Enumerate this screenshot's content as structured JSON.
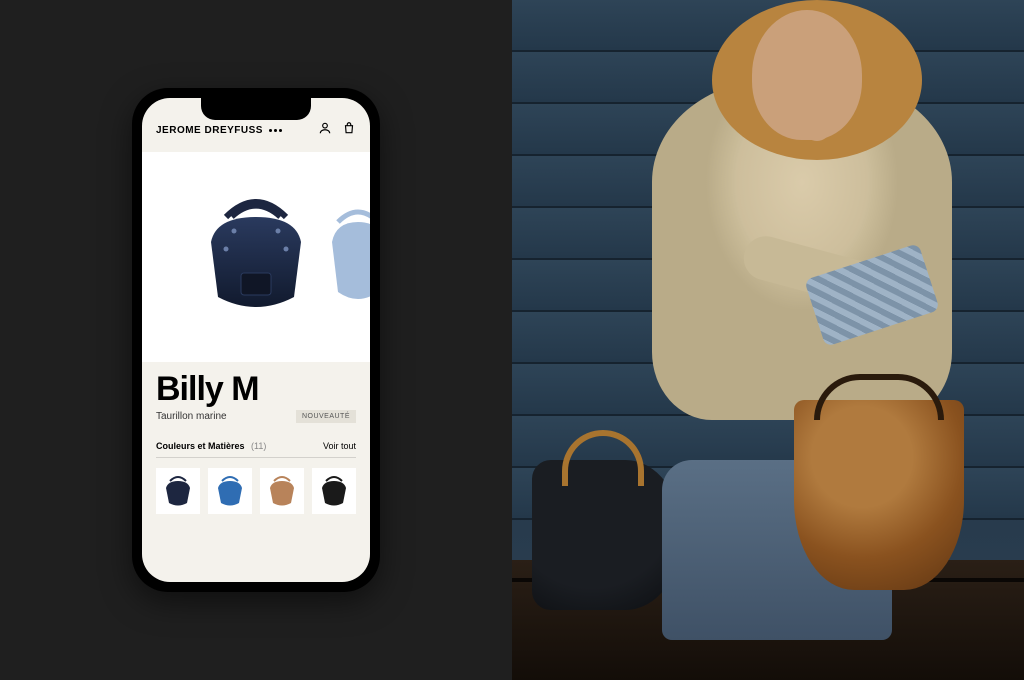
{
  "brand": "JEROME DREYFUSS",
  "product": {
    "name": "Billy M",
    "material": "Taurillon marine",
    "badge": "NOUVEAUTÉ"
  },
  "variants": {
    "section_label": "Couleurs et Matières",
    "count": "(11)",
    "view_all": "Voir tout",
    "swatch_colors": [
      "#1d2640",
      "#2f6db3",
      "#b8835a",
      "#1a1a1a"
    ]
  },
  "hero_bag_color": "#1d2640"
}
